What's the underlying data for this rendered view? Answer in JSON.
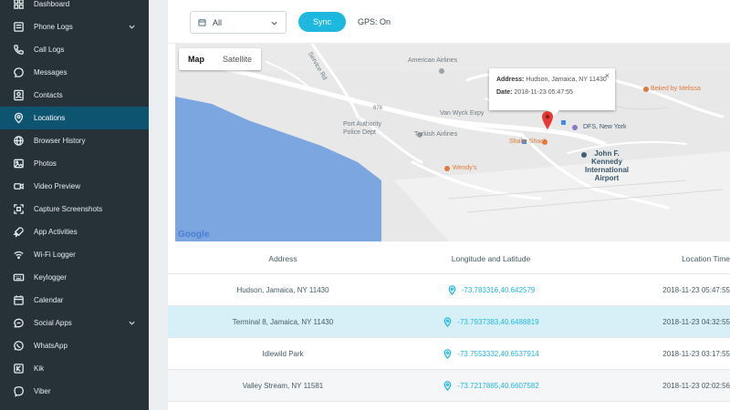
{
  "sidebar": {
    "items": [
      {
        "label": "Dashboard",
        "icon": "dashboard-icon",
        "chevron": false,
        "active": false
      },
      {
        "label": "Phone Logs",
        "icon": "phone-logs-icon",
        "chevron": true,
        "active": false
      },
      {
        "label": "Call Logs",
        "icon": "phone-icon",
        "chevron": false,
        "active": false
      },
      {
        "label": "Messages",
        "icon": "chat-bubble-icon",
        "chevron": false,
        "active": false
      },
      {
        "label": "Contacts",
        "icon": "contacts-icon",
        "chevron": false,
        "active": false
      },
      {
        "label": "Locations",
        "icon": "location-pin-icon",
        "chevron": false,
        "active": true
      },
      {
        "label": "Browser History",
        "icon": "globe-icon",
        "chevron": false,
        "active": false
      },
      {
        "label": "Photos",
        "icon": "photo-icon",
        "chevron": false,
        "active": false
      },
      {
        "label": "Video Preview",
        "icon": "video-camera-icon",
        "chevron": false,
        "active": false
      },
      {
        "label": "Capture Screenshots",
        "icon": "screenshot-icon",
        "chevron": false,
        "active": false
      },
      {
        "label": "App Activities",
        "icon": "rocket-icon",
        "chevron": false,
        "active": false
      },
      {
        "label": "Wi-Fi Logger",
        "icon": "wifi-icon",
        "chevron": false,
        "active": false
      },
      {
        "label": "Keylogger",
        "icon": "keyboard-icon",
        "chevron": false,
        "active": false
      },
      {
        "label": "Calendar",
        "icon": "calendar-icon",
        "chevron": false,
        "active": false
      },
      {
        "label": "Social Apps",
        "icon": "social-chat-icon",
        "chevron": true,
        "active": false
      },
      {
        "label": "WhatsApp",
        "icon": "whatsapp-icon",
        "chevron": false,
        "active": false
      },
      {
        "label": "Kik",
        "icon": "kik-icon",
        "chevron": false,
        "active": false
      },
      {
        "label": "Viber",
        "icon": "viber-icon",
        "chevron": false,
        "active": false
      }
    ]
  },
  "toolbar": {
    "filter_value": "All",
    "sync_label": "Sync",
    "gps_status": "GPS: On"
  },
  "map": {
    "tabs": [
      {
        "label": "Map",
        "active": true
      },
      {
        "label": "Satellite",
        "active": false
      }
    ],
    "labels": {
      "american_airlines": "American Airlines",
      "beked": "Beked by Melissa",
      "van_wyck": "Van Wyck Expy",
      "port_authority": "Port Authority\nPolice Dept",
      "turkish": "Turkish Airlines",
      "shake_shack": "Shake Shack",
      "dfs": "DFS, New York",
      "wendys": "Wendy's",
      "jfk": "John F.\nKennedy\nInternational\nAirport",
      "service_rd": "Service Rd",
      "route_678": "678"
    },
    "attribution": "Google",
    "info_window": {
      "address_label": "Address:",
      "address_value": "Hudson, Jamaica, NY 11430",
      "date_label": "Date:",
      "date_value": "2018-11-23 05:47:55",
      "close_symbol": "×"
    }
  },
  "table": {
    "columns": [
      "Address",
      "Longitude and Latitude",
      "Location Time"
    ],
    "rows": [
      {
        "address": "Hudson, Jamaica, NY 11430",
        "coords": "-73.783316,40.642579",
        "time": "2018-11-23 05:47:55"
      },
      {
        "address": "Terminal 8, Jamaica, NY 11430",
        "coords": "-73.7937383,40.6488819",
        "time": "2018-11-23 04:32:55"
      },
      {
        "address": "Idlewild Park",
        "coords": "-73.7553332,40.6537914",
        "time": "2018-11-23 03:17:55"
      },
      {
        "address": "Valley Stream, NY 11581",
        "coords": "-73.7217865,40.6607582",
        "time": "2018-11-23 02:02:56"
      }
    ]
  },
  "colors": {
    "sidebar_bg": "#263238",
    "sidebar_active": "#0d5470",
    "accent": "#1eb8de",
    "selected_row": "#d7f0f7",
    "pin": "#e53935"
  }
}
